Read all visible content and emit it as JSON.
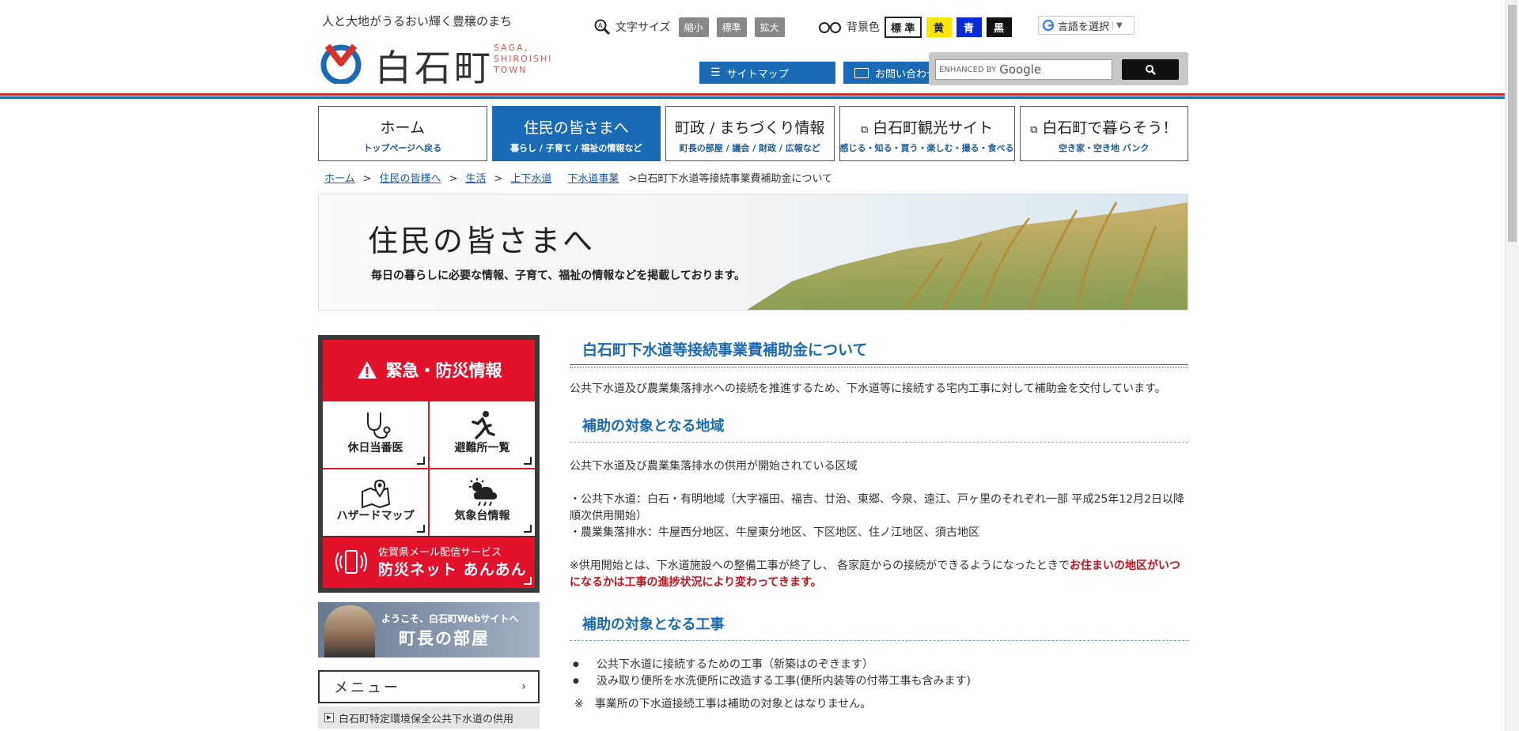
{
  "header": {
    "tagline": "人と大地がうるおい輝く豊穣のまち",
    "logo_jp": "白石町",
    "logo_en": "SAGA,\nSHIROISHI\nTOWN",
    "font_size_label": "文字サイズ",
    "font_small": "縮小",
    "font_standard": "標準",
    "font_large": "拡大",
    "bg_label": "背景色",
    "bg_standard": "標 準",
    "bg_yellow": "黄",
    "bg_blue": "青",
    "bg_black": "黒",
    "language": "言語を選択",
    "sitemap": "サイトマップ",
    "contact": "お問い合わせ",
    "search_enhanced": "ENHANCED BY",
    "search_brand": "Google"
  },
  "nav": [
    {
      "main": "ホーム",
      "sub": "トップページへ戻る"
    },
    {
      "main": "住民の皆さまへ",
      "sub": "暮らし / 子育て / 福祉の情報など"
    },
    {
      "main": "町政 / まちづくり情報",
      "sub": "町長の部屋 / 議会 / 財政 / 広報など"
    },
    {
      "main": "白石町観光サイト",
      "sub": "感じる・知る・買う・楽しむ・撮る・食べる"
    },
    {
      "main": "白石町で暮らそう！",
      "sub": "空き家・空き地 バンク"
    }
  ],
  "breadcrumb": {
    "items": [
      "ホーム",
      "住民の皆様へ",
      "生活",
      "上下水道",
      "下水道事業"
    ],
    "sep": ">",
    "current": ">白石町下水道等接続事業費補助金について"
  },
  "hero": {
    "title": "住民の皆さまへ",
    "desc": "毎日の暮らしに必要な情報、子育て、福祉の情報などを掲載しております。"
  },
  "sidebar": {
    "emergency": "緊急・防災情報",
    "cells": [
      "休日当番医",
      "避難所一覧",
      "ハザードマップ",
      "気象台情報"
    ],
    "anshin_small": "佐賀県メール配信サービス",
    "anshin_big": "防災ネット あんあん",
    "mayor_small": "ようこそ、白石町Webサイトへ",
    "mayor_big": "町長の部屋",
    "menu": "メニュー",
    "menu_item": "白石町特定環境保全公共下水道の供用"
  },
  "content": {
    "title": "白石町下水道等接続事業費補助金について",
    "intro": "公共下水道及び農業集落排水への接続を推進するため、下水道等に接続する宅内工事に対して補助金を交付しています。",
    "h_area": "補助の対象となる地域",
    "area_p1": "公共下水道及び農業集落排水の供用が開始されている区域",
    "area_p2": "・公共下水道：白石・有明地域（大字福田、福吉、廿治、東郷、今泉、遠江、戸ヶ里のそれぞれ一部 平成25年12月2日以降順次供用開始）",
    "area_p3": "・農業集落排水：牛屋西分地区、牛屋東分地区、下区地区、住ノ江地区、須古地区",
    "note_pre": "※供用開始とは、下水道施設への整備工事が終了し、 各家庭からの接続ができるようになったときで",
    "note_red": "お住まいの地区がいつになるかは工事の進捗状況により変わってきます。",
    "h_work": "補助の対象となる工事",
    "works": [
      "公共下水道に接続するための工事（新築はのぞきます）",
      "汲み取り便所を水洗便所に改造する工事(便所内装等の付帯工事も含みます)"
    ],
    "work_note": "※　事業所の下水道接続工事は補助の対象とはなりません。"
  }
}
